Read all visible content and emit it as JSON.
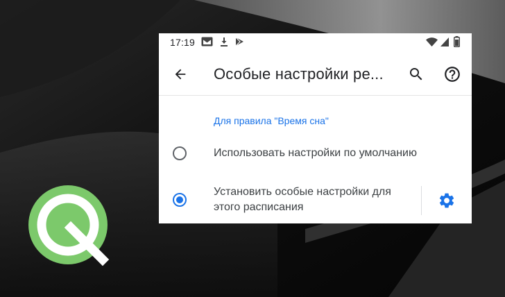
{
  "statusbar": {
    "time": "17:19",
    "left_icons": [
      "gmail-icon",
      "download-icon",
      "play-store-icon"
    ],
    "right_icons": [
      "wifi-icon",
      "cell-signal-icon",
      "battery-icon"
    ]
  },
  "appbar": {
    "title": "Особые настройки ре...",
    "back_icon": "arrow-back-icon",
    "search_icon": "search-icon",
    "help_icon": "help-icon"
  },
  "section_header": "Для правила \"Время сна\"",
  "options": [
    {
      "label": "Использовать настройки по умолчанию",
      "selected": false
    },
    {
      "label_line1": "Установить особые настройки для",
      "label_line2": "этого расписания",
      "selected": true
    }
  ],
  "colors": {
    "accent": "#1a73e8",
    "logo_green": "#7cc96b"
  }
}
